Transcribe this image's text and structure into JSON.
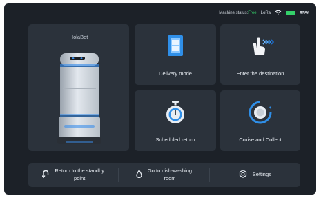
{
  "status": {
    "machine_status_label": "Machine status:",
    "machine_status_value": "Free",
    "network": "LoRa",
    "battery": "95%",
    "battery_level": 0.95,
    "colors": {
      "free": "#34d16a"
    }
  },
  "robot_panel": {
    "name": "HolaBot"
  },
  "cards": {
    "delivery": {
      "label": "Delivery mode",
      "icon": "delivery-phone-icon"
    },
    "destination": {
      "label": "Enter the destination",
      "icon": "tap-hand-icon"
    },
    "scheduled": {
      "label": "Scheduled return",
      "icon": "stopwatch-icon"
    },
    "cruise": {
      "label": "Cruise and Collect",
      "icon": "cruise-ring-icon"
    }
  },
  "bottom_bar": {
    "standby": {
      "line1": "Return to the standby",
      "line2": "point",
      "icon": "return-arrow-icon"
    },
    "dishwashing": {
      "line1": "Go to dish-washing",
      "line2": "room",
      "icon": "water-drop-icon"
    },
    "settings": {
      "label": "Settings",
      "icon": "gear-icon"
    }
  },
  "colors": {
    "background": "#1c2128",
    "card": "#2b323b",
    "accent_blue": "#3a8eea"
  }
}
